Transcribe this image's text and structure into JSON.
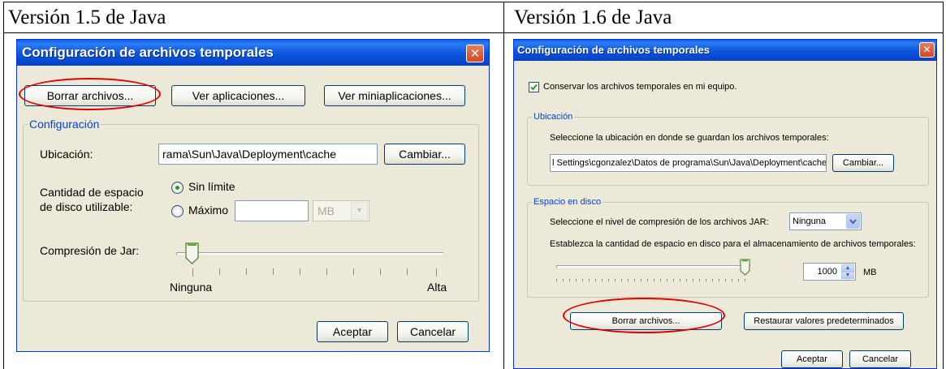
{
  "columns": [
    {
      "title": "Versión 1.5 de Java"
    },
    {
      "title": "Versión 1.6 de Java"
    }
  ],
  "dialog15": {
    "title": "Configuración de archivos temporales",
    "close_glyph": "✕",
    "buttons": {
      "delete": "Borrar archivos...",
      "view_apps": "Ver aplicaciones...",
      "view_applets": "Ver miniaplicaciones...",
      "change": "Cambiar...",
      "ok": "Aceptar",
      "cancel": "Cancelar"
    },
    "group_label": "Configuración",
    "location_label": "Ubicación:",
    "location_value": "rama\\Sun\\Java\\Deployment\\cache",
    "disk_label_1": "Cantidad de espacio",
    "disk_label_2": "de disco utilizable:",
    "unlimited_label": "Sin límite",
    "max_label": "Máximo",
    "max_value": "",
    "unit": "MB",
    "jar_label": "Compresión de Jar:",
    "slider_min": "Ninguna",
    "slider_max": "Alta"
  },
  "dialog16": {
    "title": "Configuración de archivos temporales",
    "close_glyph": "✕",
    "keep_label": "Conservar los archivos temporales en mi equipo.",
    "location_group": "Ubicación",
    "location_desc": "Seleccione la ubicación en donde se guardan los archivos temporales:",
    "location_value": "l Settings\\cgonzalez\\Datos de programa\\Sun\\Java\\Deployment\\cache",
    "change": "Cambiar...",
    "disk_group": "Espacio en disco",
    "compression_label": "Seleccione el nivel de compresión de los archivos JAR:",
    "compression_value": "Ninguna",
    "space_label": "Establezca la cantidad de espacio en disco para el almacenamiento de archivos temporales:",
    "space_value": "1000",
    "unit": "MB",
    "delete": "Borrar archivos...",
    "restore": "Restaurar valores predeterminados",
    "ok": "Aceptar",
    "cancel": "Cancelar"
  }
}
